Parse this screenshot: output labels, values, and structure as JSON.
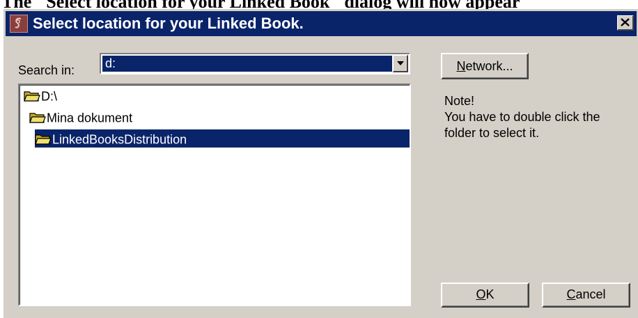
{
  "page": {
    "caption": "The \"Select location for your Linked Book\" dialog will now appear"
  },
  "dialog": {
    "title": "Select location for your Linked Book.",
    "search_label": "Search in:",
    "search_value": "d:",
    "tree": [
      {
        "label": "D:\\",
        "selected": false
      },
      {
        "label": "Mina dokument",
        "selected": false
      },
      {
        "label": "LinkedBooksDistribution",
        "selected": true
      }
    ],
    "network_button": {
      "mnemonic": "N",
      "rest": "etwork..."
    },
    "note_title": "Note!",
    "note_line1": "You have to double click the",
    "note_line2": "folder to select it.",
    "ok_button": {
      "mnemonic": "O",
      "rest": "K"
    },
    "cancel_button": {
      "mnemonic": "C",
      "rest": "ancel"
    }
  },
  "colors": {
    "titlebar": "#0a246a",
    "dialog_face": "#d4d0c8",
    "selection": "#0a246a"
  }
}
